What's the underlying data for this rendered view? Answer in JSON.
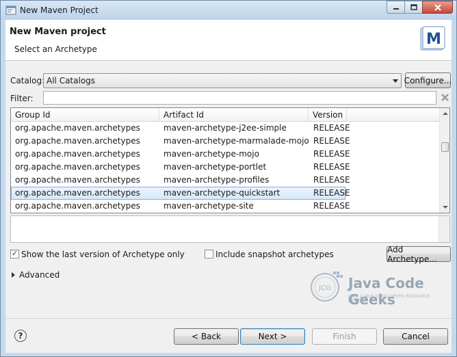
{
  "window": {
    "title": "New Maven Project",
    "icon": "maven-icon"
  },
  "header": {
    "title": "New Maven project",
    "subtitle": "Select an Archetype",
    "logo_letter": "M"
  },
  "catalog": {
    "label": "Catalog:",
    "selected": "All Catalogs",
    "configure_label": "Configure..."
  },
  "filter": {
    "label": "Filter:",
    "value": ""
  },
  "table": {
    "columns": [
      "Group Id",
      "Artifact Id",
      "Version"
    ],
    "rows": [
      {
        "group": "org.apache.maven.archetypes",
        "artifact": "maven-archetype-j2ee-simple",
        "version": "RELEASE"
      },
      {
        "group": "org.apache.maven.archetypes",
        "artifact": "maven-archetype-marmalade-mojo",
        "version": "RELEASE"
      },
      {
        "group": "org.apache.maven.archetypes",
        "artifact": "maven-archetype-mojo",
        "version": "RELEASE"
      },
      {
        "group": "org.apache.maven.archetypes",
        "artifact": "maven-archetype-portlet",
        "version": "RELEASE"
      },
      {
        "group": "org.apache.maven.archetypes",
        "artifact": "maven-archetype-profiles",
        "version": "RELEASE"
      },
      {
        "group": "org.apache.maven.archetypes",
        "artifact": "maven-archetype-quickstart",
        "version": "RELEASE"
      },
      {
        "group": "org.apache.maven.archetypes",
        "artifact": "maven-archetype-site",
        "version": "RELEASE"
      }
    ],
    "selected_row": 5
  },
  "options": {
    "last_version_label": "Show the last version of Archetype only",
    "last_version_checked": true,
    "snapshot_label": "Include snapshot archetypes",
    "snapshot_checked": false,
    "add_archetype_label": "Add Archetype..."
  },
  "advanced": {
    "label": "Advanced"
  },
  "watermark": {
    "text": "Java Code Geeks",
    "subtitle": "JAVA 2 JAVA DEVELOPERS RESOURCE CENTER",
    "badge": "JCG"
  },
  "footer": {
    "back_label": "< Back",
    "next_label": "Next >",
    "finish_label": "Finish",
    "cancel_label": "Cancel"
  },
  "colors": {
    "selection": "#d7e9fa",
    "window_frame": "#c5d9ec"
  }
}
